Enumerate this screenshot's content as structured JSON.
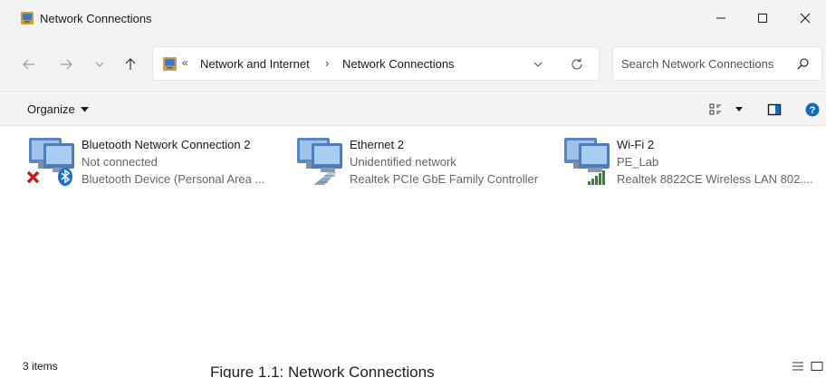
{
  "window": {
    "title": "Network Connections",
    "icon": "network-connections-icon",
    "minimize_icon": "minimize-icon",
    "maximize_icon": "maximize-icon",
    "close_icon": "close-icon"
  },
  "navigation": {
    "back_icon": "arrow-left-icon",
    "forward_icon": "arrow-right-icon",
    "recent_icon": "chevron-down-icon",
    "up_icon": "arrow-up-icon"
  },
  "address_bar": {
    "overflow": "«",
    "crumbs": [
      "Network and Internet",
      "Network Connections"
    ],
    "separator": "›"
  },
  "search": {
    "placeholder": "Search Network Connections"
  },
  "command_bar": {
    "organize_label": "Organize",
    "accent_color": "#0f6cbd"
  },
  "connections": [
    {
      "name": "Bluetooth Network Connection 2",
      "status": "Not connected",
      "device": "Bluetooth Device (Personal Area ...",
      "overlay_icons": [
        "red-x-icon",
        "bluetooth-icon"
      ]
    },
    {
      "name": "Ethernet 2",
      "status": "Unidentified network",
      "device": "Realtek PCIe GbE Family Controller",
      "overlay_icons": [
        "ethernet-cable-icon"
      ]
    },
    {
      "name": "Wi-Fi 2",
      "status": "PE_Lab",
      "device": "Realtek 8822CE Wireless LAN 802....",
      "overlay_icons": [
        "wifi-signal-icon"
      ]
    }
  ],
  "status_bar": {
    "item_count": "3 items",
    "caption": "Figure 1.1: Network Connections"
  }
}
